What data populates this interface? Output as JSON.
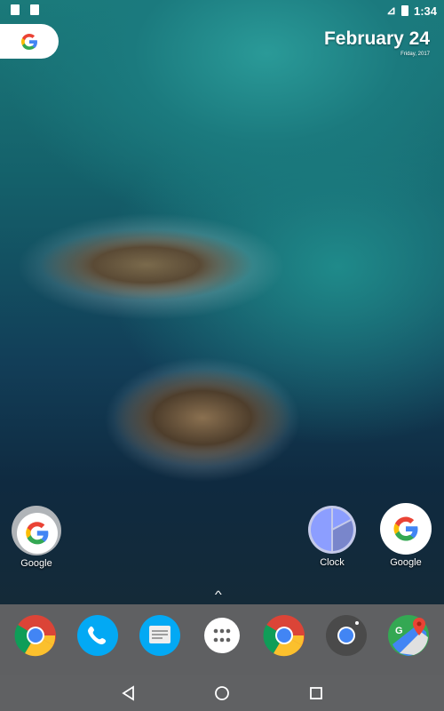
{
  "status": {
    "time": "1:34"
  },
  "search": {
    "icon": "google-g-icon"
  },
  "date": {
    "main": "February 24",
    "sub": "Friday, 2017"
  },
  "home_apps": [
    {
      "label": "Google",
      "icon": "google-icon"
    },
    {
      "label": "Clock",
      "icon": "clock-icon"
    },
    {
      "label": "Google",
      "icon": "google-icon"
    }
  ],
  "dock": [
    "chrome-icon",
    "phone-icon",
    "messages-icon",
    "app-drawer-icon",
    "chrome-icon",
    "camera-icon",
    "maps-icon"
  ],
  "nav": [
    "back-icon",
    "home-icon",
    "recents-icon"
  ]
}
